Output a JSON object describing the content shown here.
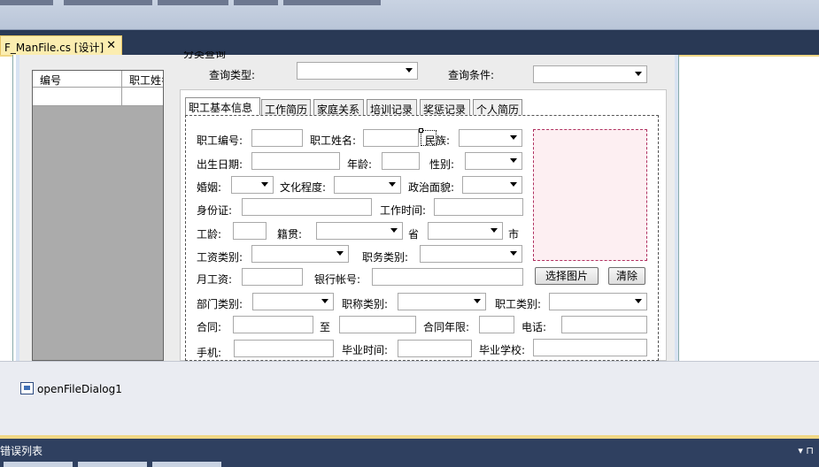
{
  "document_tab": {
    "title": "F_ManFile.cs [设计]",
    "close": "✕"
  },
  "grid": {
    "headers": [
      "编号",
      "职工姓名"
    ]
  },
  "query": {
    "group_title": "分类查询",
    "type_label": "查询类型:",
    "cond_label": "查询条件:"
  },
  "tabs": [
    "职工基本信息",
    "工作简历",
    "家庭关系",
    "培训记录",
    "奖惩记录",
    "个人简历"
  ],
  "form": {
    "emp_no": "职工编号:",
    "emp_name": "职工姓名:",
    "nation": "民族:",
    "birth": "出生日期:",
    "age": "年龄:",
    "sex": "性别:",
    "marriage": "婚姻:",
    "education": "文化程度:",
    "politics": "政治面貌:",
    "idcard": "身份证:",
    "work_time": "工作时间:",
    "seniority": "工龄:",
    "native": "籍贯:",
    "province": "省",
    "city": "市",
    "wage_type": "工资类别:",
    "duty_type": "职务类别:",
    "salary": "月工资:",
    "bank": "银行帐号:",
    "dept": "部门类别:",
    "title_type": "职称类别:",
    "emp_type": "职工类别:",
    "contract": "合同:",
    "to": "至",
    "contract_years": "合同年限:",
    "phone": "电话:",
    "mobile": "手机:",
    "grad_time": "毕业时间:",
    "school": "毕业学校:",
    "select_pic": "选择图片",
    "clear": "清除"
  },
  "tray": {
    "component": "openFileDialog1"
  },
  "error_list": {
    "title": "错误列表",
    "controls": "▾ ⊓"
  },
  "colors": {
    "band": "#293955",
    "active_tab": "#fbedb0",
    "picture_bg": "#fdeff2"
  }
}
